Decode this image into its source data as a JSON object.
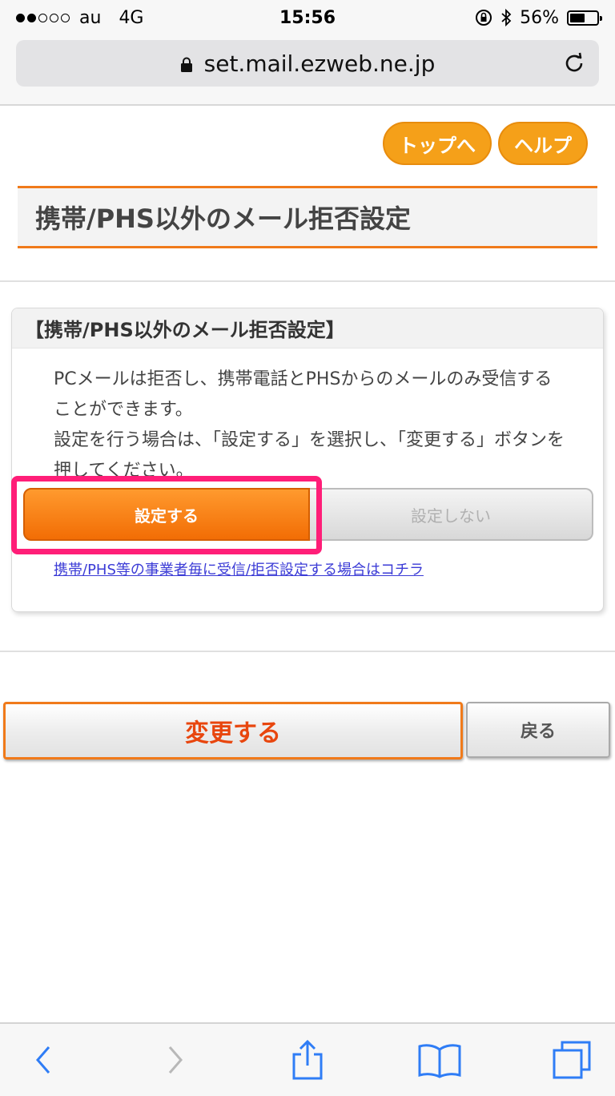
{
  "status_bar": {
    "carrier": "au",
    "network": "4G",
    "time": "15:56",
    "battery": "56%",
    "battery_level": 0.56,
    "signal_bars_filled": 2,
    "signal_bars_total": 5
  },
  "url_bar": {
    "url": "set.mail.ezweb.ne.jp"
  },
  "nav": {
    "top_label": "トップへ",
    "help_label": "ヘルプ"
  },
  "page": {
    "title": "携帯/PHS以外のメール拒否設定"
  },
  "card": {
    "header": "【携帯/PHS以外のメール拒否設定】",
    "description_1": "PCメールは拒否し、携帯電話とPHSからのメールのみ受信することができます。",
    "description_2": "設定を行う場合は、「設定する」を選択し、「変更する」ボタンを押してください。",
    "option_on": "設定する",
    "option_off": "設定しない",
    "link": "携帯/PHS等の事業者毎に受信/拒否設定する場合はコチラ"
  },
  "actions": {
    "change_label": "変更する",
    "back_label": "戻る"
  },
  "colors": {
    "accent_orange": "#f5a019",
    "highlight_pink": "#ff1e78",
    "ios_blue": "#2f7df6"
  }
}
